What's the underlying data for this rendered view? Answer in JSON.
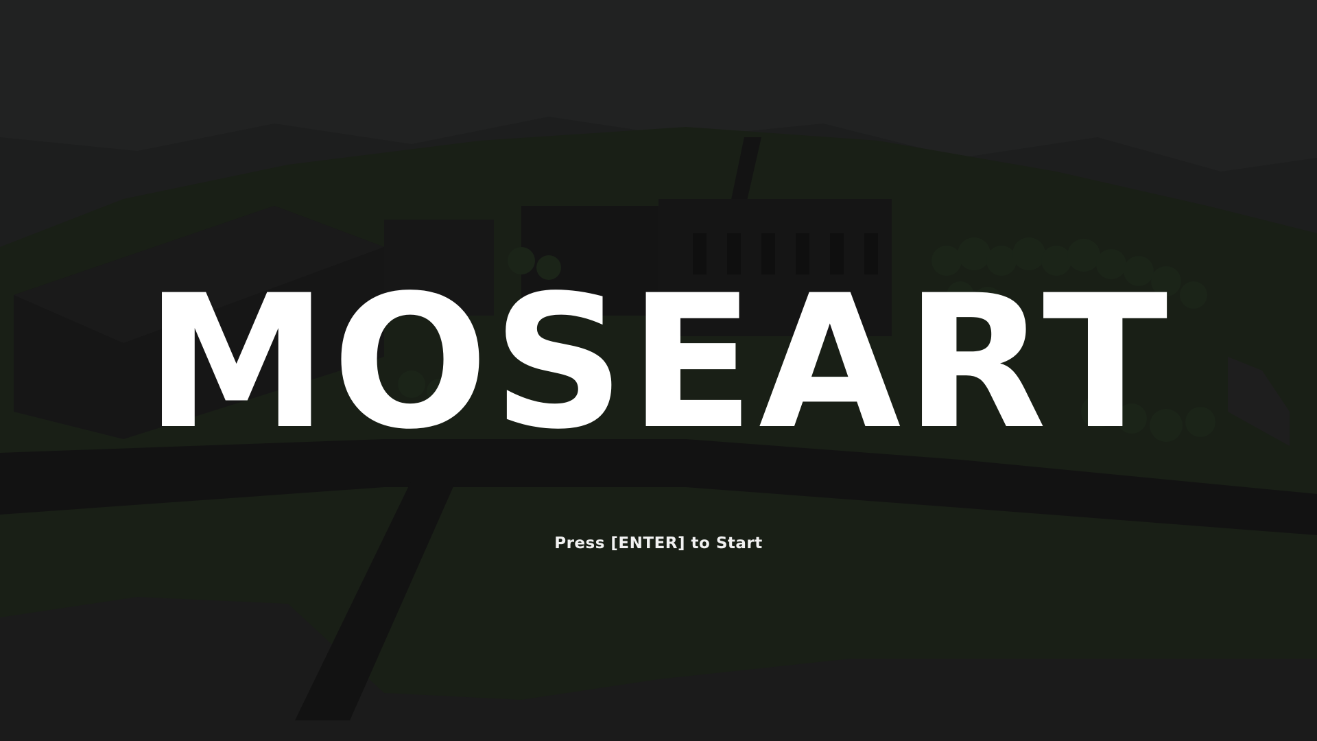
{
  "game": {
    "title": "MOSEART",
    "prompt": "Press [ENTER] to Start"
  },
  "scene": {
    "description_icon": "city-landscape-background",
    "colors": {
      "sky": "#222323",
      "grass": "#1d2419",
      "road": "#141414",
      "building": "#191919",
      "tree": "#1f2a1c",
      "title_text": "#ffffff"
    }
  }
}
